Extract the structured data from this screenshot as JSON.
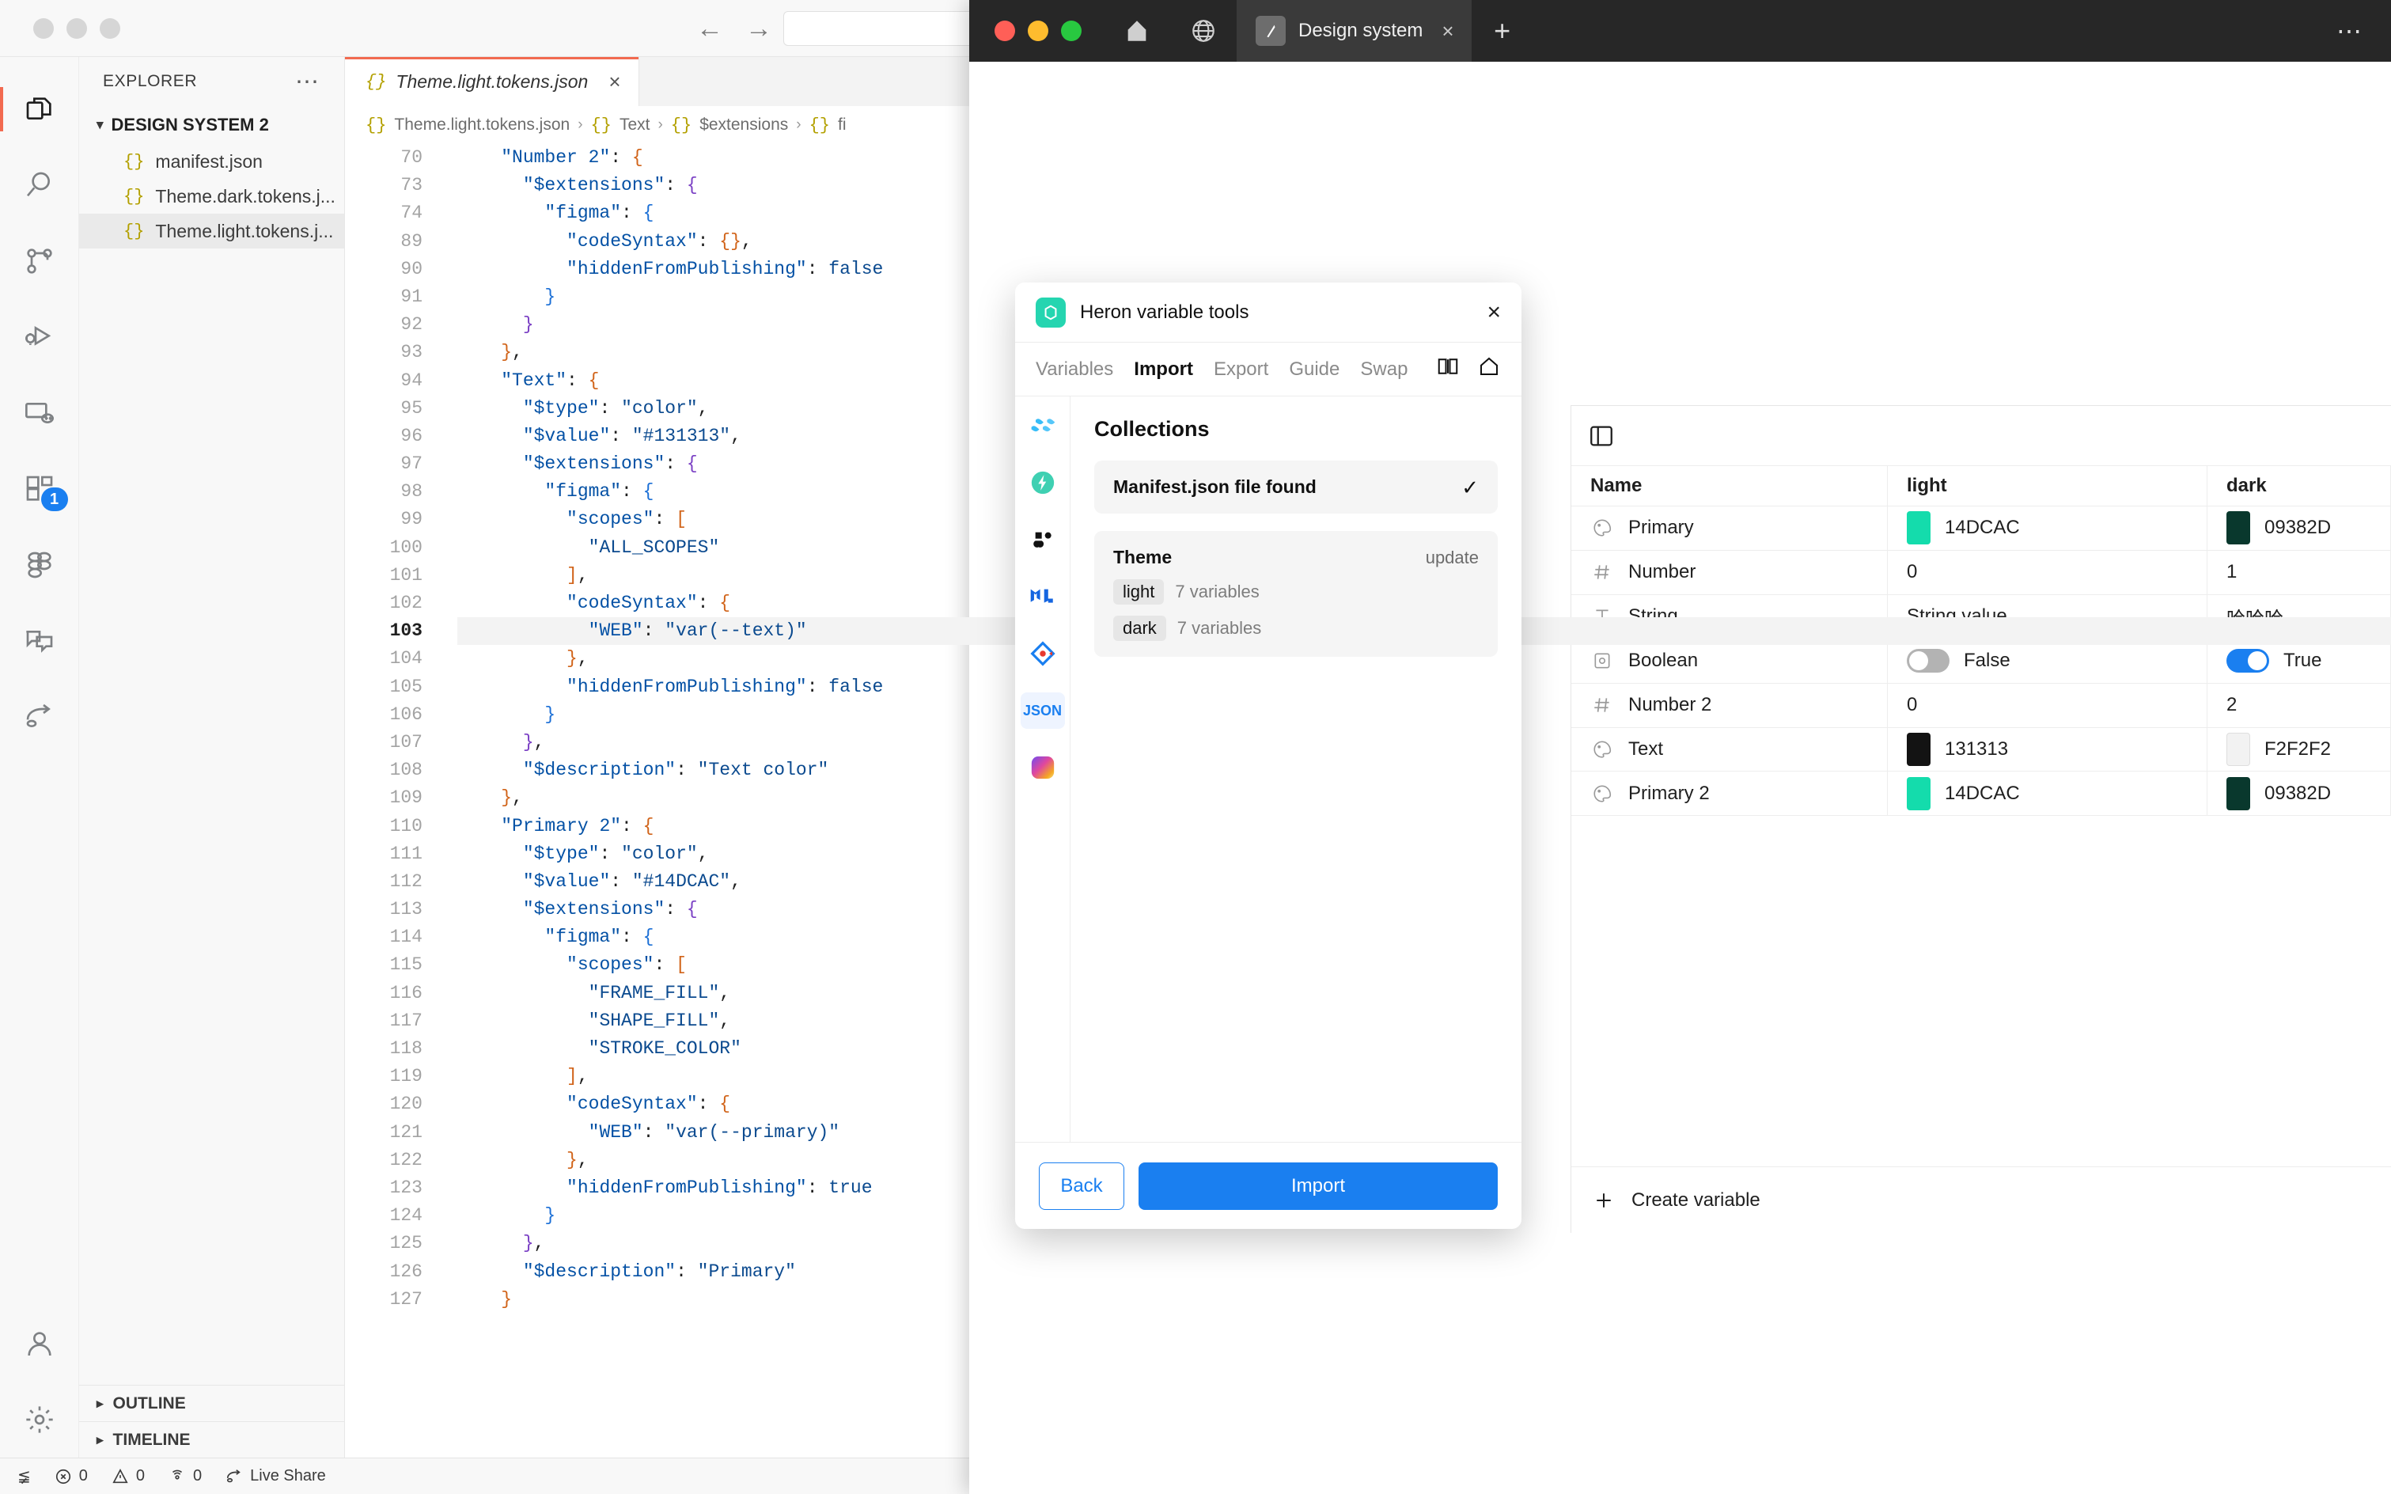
{
  "vscode": {
    "explorer": {
      "title": "EXPLORER",
      "more_icon": "ellipsis-icon",
      "root": "DESIGN SYSTEM 2",
      "files": [
        {
          "name": "manifest.json"
        },
        {
          "name": "Theme.dark.tokens.j..."
        },
        {
          "name": "Theme.light.tokens.j..."
        }
      ],
      "panels": [
        "OUTLINE",
        "TIMELINE"
      ]
    },
    "activitybar": [
      {
        "name": "explorer-icon",
        "badge": ""
      },
      {
        "name": "search-icon",
        "badge": ""
      },
      {
        "name": "source-control-icon",
        "badge": ""
      },
      {
        "name": "run-and-debug-icon",
        "badge": ""
      },
      {
        "name": "remote-explorer-icon",
        "badge": ""
      },
      {
        "name": "extensions-icon",
        "badge": "1"
      },
      {
        "name": "figma-icon",
        "badge": ""
      },
      {
        "name": "comments-icon",
        "badge": ""
      },
      {
        "name": "live-share-icon",
        "badge": ""
      }
    ],
    "tab": {
      "label": "Theme.light.tokens.json",
      "close": "×"
    },
    "breadcrumbs": [
      "Theme.light.tokens.json",
      "Text",
      "$extensions",
      "fi"
    ],
    "statusbar": {
      "remote_icon": "remote-icon",
      "errors": "0",
      "warnings": "0",
      "ports": "0",
      "live_share": "Live Share"
    },
    "code": {
      "current_line": 103,
      "lines": [
        {
          "n": 70,
          "indent": 2,
          "tokens": [
            {
              "t": "\"Number 2\"",
              "c": "k"
            },
            {
              "t": ":",
              "c": "pn"
            },
            {
              "t": " {",
              "c": "b1"
            }
          ]
        },
        {
          "n": 73,
          "indent": 3,
          "tokens": [
            {
              "t": "\"$extensions\"",
              "c": "k"
            },
            {
              "t": ":",
              "c": "pn"
            },
            {
              "t": " {",
              "c": "b2"
            }
          ]
        },
        {
          "n": 74,
          "indent": 4,
          "tokens": [
            {
              "t": "\"figma\"",
              "c": "k"
            },
            {
              "t": ":",
              "c": "pn"
            },
            {
              "t": " {",
              "c": "b3"
            }
          ]
        },
        {
          "n": 89,
          "indent": 5,
          "tokens": [
            {
              "t": "\"codeSyntax\"",
              "c": "k"
            },
            {
              "t": ":",
              "c": "pn"
            },
            {
              "t": " {}",
              "c": "b1"
            },
            {
              "t": ",",
              "c": "pn"
            }
          ]
        },
        {
          "n": 90,
          "indent": 5,
          "tokens": [
            {
              "t": "\"hiddenFromPublishing\"",
              "c": "k"
            },
            {
              "t": ":",
              "c": "pn"
            },
            {
              "t": " false",
              "c": "s"
            }
          ]
        },
        {
          "n": 91,
          "indent": 4,
          "tokens": [
            {
              "t": "}",
              "c": "b3"
            }
          ]
        },
        {
          "n": 92,
          "indent": 3,
          "tokens": [
            {
              "t": "}",
              "c": "b2"
            }
          ]
        },
        {
          "n": 93,
          "indent": 2,
          "tokens": [
            {
              "t": "}",
              "c": "b1"
            },
            {
              "t": ",",
              "c": "pn"
            }
          ]
        },
        {
          "n": 94,
          "indent": 2,
          "tokens": [
            {
              "t": "\"Text\"",
              "c": "k"
            },
            {
              "t": ":",
              "c": "pn"
            },
            {
              "t": " {",
              "c": "b1"
            }
          ]
        },
        {
          "n": 95,
          "indent": 3,
          "tokens": [
            {
              "t": "\"$type\"",
              "c": "k"
            },
            {
              "t": ":",
              "c": "pn"
            },
            {
              "t": " \"color\"",
              "c": "s"
            },
            {
              "t": ",",
              "c": "pn"
            }
          ]
        },
        {
          "n": 96,
          "indent": 3,
          "tokens": [
            {
              "t": "\"$value\"",
              "c": "k"
            },
            {
              "t": ":",
              "c": "pn"
            },
            {
              "t": " \"#131313\"",
              "c": "s"
            },
            {
              "t": ",",
              "c": "pn"
            }
          ]
        },
        {
          "n": 97,
          "indent": 3,
          "tokens": [
            {
              "t": "\"$extensions\"",
              "c": "k"
            },
            {
              "t": ":",
              "c": "pn"
            },
            {
              "t": " {",
              "c": "b2"
            }
          ]
        },
        {
          "n": 98,
          "indent": 4,
          "tokens": [
            {
              "t": "\"figma\"",
              "c": "k"
            },
            {
              "t": ":",
              "c": "pn"
            },
            {
              "t": " {",
              "c": "b3"
            }
          ]
        },
        {
          "n": 99,
          "indent": 5,
          "tokens": [
            {
              "t": "\"scopes\"",
              "c": "k"
            },
            {
              "t": ":",
              "c": "pn"
            },
            {
              "t": " [",
              "c": "b1"
            }
          ]
        },
        {
          "n": 100,
          "indent": 6,
          "tokens": [
            {
              "t": "\"ALL_SCOPES\"",
              "c": "s"
            }
          ]
        },
        {
          "n": 101,
          "indent": 5,
          "tokens": [
            {
              "t": "]",
              "c": "b1"
            },
            {
              "t": ",",
              "c": "pn"
            }
          ]
        },
        {
          "n": 102,
          "indent": 5,
          "tokens": [
            {
              "t": "\"codeSyntax\"",
              "c": "k"
            },
            {
              "t": ":",
              "c": "pn"
            },
            {
              "t": " {",
              "c": "b1"
            }
          ]
        },
        {
          "n": 103,
          "indent": 6,
          "tokens": [
            {
              "t": "\"WEB\"",
              "c": "k"
            },
            {
              "t": ":",
              "c": "pn"
            },
            {
              "t": " \"var(--text)\"",
              "c": "s"
            }
          ]
        },
        {
          "n": 104,
          "indent": 5,
          "tokens": [
            {
              "t": "}",
              "c": "b1"
            },
            {
              "t": ",",
              "c": "pn"
            }
          ]
        },
        {
          "n": 105,
          "indent": 5,
          "tokens": [
            {
              "t": "\"hiddenFromPublishing\"",
              "c": "k"
            },
            {
              "t": ":",
              "c": "pn"
            },
            {
              "t": " false",
              "c": "s"
            }
          ]
        },
        {
          "n": 106,
          "indent": 4,
          "tokens": [
            {
              "t": "}",
              "c": "b3"
            }
          ]
        },
        {
          "n": 107,
          "indent": 3,
          "tokens": [
            {
              "t": "}",
              "c": "b2"
            },
            {
              "t": ",",
              "c": "pn"
            }
          ]
        },
        {
          "n": 108,
          "indent": 3,
          "tokens": [
            {
              "t": "\"$description\"",
              "c": "k"
            },
            {
              "t": ":",
              "c": "pn"
            },
            {
              "t": " \"Text color\"",
              "c": "s"
            }
          ]
        },
        {
          "n": 109,
          "indent": 2,
          "tokens": [
            {
              "t": "}",
              "c": "b1"
            },
            {
              "t": ",",
              "c": "pn"
            }
          ]
        },
        {
          "n": 110,
          "indent": 2,
          "tokens": [
            {
              "t": "\"Primary 2\"",
              "c": "k"
            },
            {
              "t": ":",
              "c": "pn"
            },
            {
              "t": " {",
              "c": "b1"
            }
          ]
        },
        {
          "n": 111,
          "indent": 3,
          "tokens": [
            {
              "t": "\"$type\"",
              "c": "k"
            },
            {
              "t": ":",
              "c": "pn"
            },
            {
              "t": " \"color\"",
              "c": "s"
            },
            {
              "t": ",",
              "c": "pn"
            }
          ]
        },
        {
          "n": 112,
          "indent": 3,
          "tokens": [
            {
              "t": "\"$value\"",
              "c": "k"
            },
            {
              "t": ":",
              "c": "pn"
            },
            {
              "t": " \"#14DCAC\"",
              "c": "s"
            },
            {
              "t": ",",
              "c": "pn"
            }
          ]
        },
        {
          "n": 113,
          "indent": 3,
          "tokens": [
            {
              "t": "\"$extensions\"",
              "c": "k"
            },
            {
              "t": ":",
              "c": "pn"
            },
            {
              "t": " {",
              "c": "b2"
            }
          ]
        },
        {
          "n": 114,
          "indent": 4,
          "tokens": [
            {
              "t": "\"figma\"",
              "c": "k"
            },
            {
              "t": ":",
              "c": "pn"
            },
            {
              "t": " {",
              "c": "b3"
            }
          ]
        },
        {
          "n": 115,
          "indent": 5,
          "tokens": [
            {
              "t": "\"scopes\"",
              "c": "k"
            },
            {
              "t": ":",
              "c": "pn"
            },
            {
              "t": " [",
              "c": "b1"
            }
          ]
        },
        {
          "n": 116,
          "indent": 6,
          "tokens": [
            {
              "t": "\"FRAME_FILL\"",
              "c": "s"
            },
            {
              "t": ",",
              "c": "pn"
            }
          ]
        },
        {
          "n": 117,
          "indent": 6,
          "tokens": [
            {
              "t": "\"SHAPE_FILL\"",
              "c": "s"
            },
            {
              "t": ",",
              "c": "pn"
            }
          ]
        },
        {
          "n": 118,
          "indent": 6,
          "tokens": [
            {
              "t": "\"STROKE_COLOR\"",
              "c": "s"
            }
          ]
        },
        {
          "n": 119,
          "indent": 5,
          "tokens": [
            {
              "t": "]",
              "c": "b1"
            },
            {
              "t": ",",
              "c": "pn"
            }
          ]
        },
        {
          "n": 120,
          "indent": 5,
          "tokens": [
            {
              "t": "\"codeSyntax\"",
              "c": "k"
            },
            {
              "t": ":",
              "c": "pn"
            },
            {
              "t": " {",
              "c": "b1"
            }
          ]
        },
        {
          "n": 121,
          "indent": 6,
          "tokens": [
            {
              "t": "\"WEB\"",
              "c": "k"
            },
            {
              "t": ":",
              "c": "pn"
            },
            {
              "t": " \"var(--primary)\"",
              "c": "s"
            }
          ]
        },
        {
          "n": 122,
          "indent": 5,
          "tokens": [
            {
              "t": "}",
              "c": "b1"
            },
            {
              "t": ",",
              "c": "pn"
            }
          ]
        },
        {
          "n": 123,
          "indent": 5,
          "tokens": [
            {
              "t": "\"hiddenFromPublishing\"",
              "c": "k"
            },
            {
              "t": ":",
              "c": "pn"
            },
            {
              "t": " true",
              "c": "s"
            }
          ]
        },
        {
          "n": 124,
          "indent": 4,
          "tokens": [
            {
              "t": "}",
              "c": "b3"
            }
          ]
        },
        {
          "n": 125,
          "indent": 3,
          "tokens": [
            {
              "t": "}",
              "c": "b2"
            },
            {
              "t": ",",
              "c": "pn"
            }
          ]
        },
        {
          "n": 126,
          "indent": 3,
          "tokens": [
            {
              "t": "\"$description\"",
              "c": "k"
            },
            {
              "t": ":",
              "c": "pn"
            },
            {
              "t": " \"Primary\"",
              "c": "s"
            }
          ]
        },
        {
          "n": 127,
          "indent": 2,
          "tokens": [
            {
              "t": "}",
              "c": "b1"
            }
          ]
        }
      ]
    }
  },
  "figma": {
    "tab_title": "Design system",
    "tab_close": "×",
    "new_tab": "+",
    "menu": "⋯",
    "variables_table": {
      "row_count": "7",
      "columns": [
        "Name",
        "light",
        "dark"
      ],
      "create_label": "Create variable",
      "rows": [
        {
          "icon": "color-icon",
          "name": "Primary",
          "light": {
            "kind": "color",
            "swatch": "#14DCAC",
            "text": "14DCAC"
          },
          "dark": {
            "kind": "color",
            "swatch": "#09382D",
            "text": "09382D"
          }
        },
        {
          "icon": "number-icon",
          "name": "Number",
          "light": {
            "kind": "text",
            "text": "0"
          },
          "dark": {
            "kind": "text",
            "text": "1"
          }
        },
        {
          "icon": "string-icon",
          "name": "String",
          "light": {
            "kind": "text",
            "text": "String value"
          },
          "dark": {
            "kind": "text",
            "text": "哈哈哈"
          }
        },
        {
          "icon": "boolean-icon",
          "name": "Boolean",
          "light": {
            "kind": "toggle",
            "on": false,
            "text": "False"
          },
          "dark": {
            "kind": "toggle",
            "on": true,
            "text": "True"
          }
        },
        {
          "icon": "number-icon",
          "name": "Number 2",
          "light": {
            "kind": "text",
            "text": "0"
          },
          "dark": {
            "kind": "text",
            "text": "2"
          }
        },
        {
          "icon": "color-icon",
          "name": "Text",
          "light": {
            "kind": "color",
            "swatch": "#131313",
            "text": "131313"
          },
          "dark": {
            "kind": "color",
            "swatch": "#F2F2F2",
            "text": "F2F2F2"
          }
        },
        {
          "icon": "color-icon",
          "name": "Primary 2",
          "light": {
            "kind": "color",
            "swatch": "#14DCAC",
            "text": "14DCAC"
          },
          "dark": {
            "kind": "color",
            "swatch": "#09382D",
            "text": "09382D"
          }
        }
      ]
    }
  },
  "heron": {
    "title": "Heron variable tools",
    "close": "×",
    "tabs": [
      "Variables",
      "Import",
      "Export",
      "Guide",
      "Swap"
    ],
    "active_tab": "Import",
    "section_title": "Collections",
    "manifest_card": {
      "label": "Manifest.json file found",
      "check": "✓"
    },
    "theme_card": {
      "title": "Theme",
      "action": "update",
      "collections": [
        {
          "chip": "light",
          "count": "7 variables"
        },
        {
          "chip": "dark",
          "count": "7 variables"
        }
      ]
    },
    "footer": {
      "back": "Back",
      "import": "Import"
    }
  }
}
